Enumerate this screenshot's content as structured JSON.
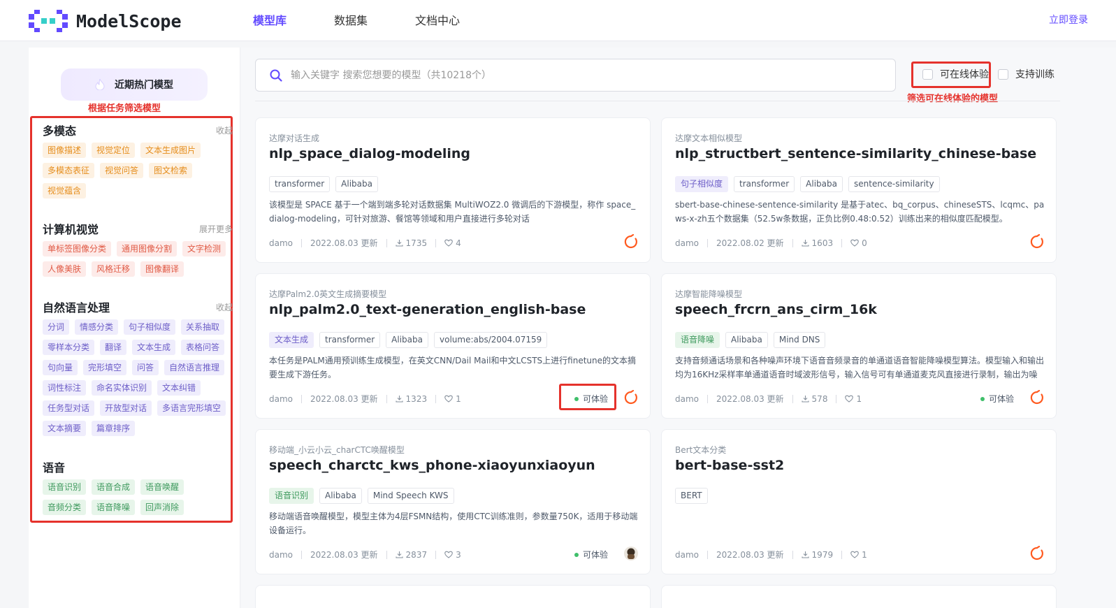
{
  "header": {
    "brand": "ModelScope",
    "nav": [
      "模型库",
      "数据集",
      "文档中心"
    ],
    "login": "立即登录"
  },
  "colors": {
    "accent": "#624aff",
    "annotation": "#e5322c"
  },
  "sidebar": {
    "hot_button": "近期热门模型",
    "annotation": "根据任务筛选模型",
    "categories": [
      {
        "title": "多模态",
        "toggle": "收起",
        "tags": [
          "图像描述",
          "视觉定位",
          "文本生成图片",
          "多模态表征",
          "视觉问答",
          "图文检索",
          "视觉蕴含"
        ]
      },
      {
        "title": "计算机视觉",
        "toggle": "展开更多",
        "tags": [
          "单标签图像分类",
          "通用图像分割",
          "文字检测",
          "人像美肤",
          "风格迁移",
          "图像翻译"
        ]
      },
      {
        "title": "自然语言处理",
        "toggle": "收起",
        "tags": [
          "分词",
          "情感分类",
          "句子相似度",
          "关系抽取",
          "零样本分类",
          "翻译",
          "文本生成",
          "表格问答",
          "句向量",
          "完形填空",
          "问答",
          "自然语言推理",
          "词性标注",
          "命名实体识别",
          "文本纠错",
          "任务型对话",
          "开放型对话",
          "多语言完形填空",
          "文本摘要",
          "篇章排序"
        ]
      },
      {
        "title": "语音",
        "toggle": "",
        "tags": [
          "语音识别",
          "语音合成",
          "语音唤醒",
          "音频分类",
          "语音降噪",
          "回声消除"
        ]
      }
    ]
  },
  "search": {
    "placeholder": "输入关键字 搜索您想要的模型（共10218个）",
    "filter_online": "可在线体验",
    "filter_train": "支持训练",
    "annotation": "筛选可在线体验的模型"
  },
  "cards": [
    {
      "sub": "达摩对话生成",
      "title": "nlp_space_dialog-modeling",
      "tags": [
        "transformer",
        "Alibaba"
      ],
      "desc": "该模型是 SPACE 基于一个端到端多轮对话数据集 MultiWOZ2.0 微调后的下游模型，称作 space_dialog-modeling，可针对旅游、餐馆等领域和用户直接进行多轮对话",
      "author": "damo",
      "date": "2022.08.03 更新",
      "downloads": "1735",
      "likes": "4",
      "experience": "",
      "icon": "damo-logo-icon"
    },
    {
      "sub": "达摩文本相似模型",
      "title": "nlp_structbert_sentence-similarity_chinese-base",
      "tags": [
        "句子相似度",
        "transformer",
        "Alibaba",
        "sentence-similarity"
      ],
      "desc": "sbert-base-chinese-sentence-similarity 是基于atec、bq_corpus、chineseSTS、lcqmc、paws-x-zh五个数据集（52.5w条数据，正负比例0.48:0.52）训练出来的相似度匹配模型。",
      "author": "damo",
      "date": "2022.08.02 更新",
      "downloads": "1603",
      "likes": "0",
      "experience": "",
      "icon": "damo-logo-icon"
    },
    {
      "sub": "达摩Palm2.0英文生成摘要模型",
      "title": "nlp_palm2.0_text-generation_english-base",
      "tags": [
        "文本生成",
        "transformer",
        "Alibaba",
        "volume:abs/2004.07159"
      ],
      "desc": "本任务是PALM通用预训练生成模型，在英文CNN/Dail Mail和中文LCSTS上进行finetune的文本摘要生成下游任务。",
      "author": "damo",
      "date": "2022.08.03 更新",
      "downloads": "1323",
      "likes": "1",
      "experience": "可体验",
      "icon": "damo-logo-icon"
    },
    {
      "sub": "达摩智能降噪模型",
      "title": "speech_frcrn_ans_cirm_16k",
      "tags": [
        "语音降噪",
        "Alibaba",
        "Mind DNS"
      ],
      "desc": "支持音频通话场景和各种噪声环境下语音音频录音的单通道语音智能降噪模型算法。模型输入和输出均为16KHz采样率单通道语音时域波形信号，输入信号可有单通道麦克风直接进行录制，输出为噪声...",
      "author": "damo",
      "date": "2022.08.03 更新",
      "downloads": "578",
      "likes": "1",
      "experience": "可体验",
      "icon": "damo-logo-icon"
    },
    {
      "sub": "移动端_小云小云_charCTC唤醒模型",
      "title": "speech_charctc_kws_phone-xiaoyunxiaoyun",
      "tags": [
        "语音识别",
        "Alibaba",
        "Mind Speech KWS"
      ],
      "desc": "移动端语音唤醒模型，模型主体为4层FSMN结构，使用CTC训练准则，参数量750K，适用于移动端设备运行。",
      "author": "damo",
      "date": "2022.08.03 更新",
      "downloads": "2837",
      "likes": "3",
      "experience": "可体验",
      "icon": "avatar-icon"
    },
    {
      "sub": "Bert文本分类",
      "title": "bert-base-sst2",
      "tags": [
        "BERT"
      ],
      "desc": "",
      "author": "damo",
      "date": "2022.08.03 更新",
      "downloads": "1979",
      "likes": "1",
      "experience": "",
      "icon": "damo-logo-icon"
    }
  ]
}
